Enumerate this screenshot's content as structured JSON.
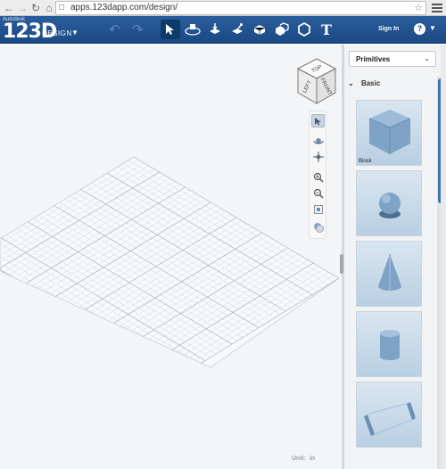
{
  "browser": {
    "url": "apps.123dapp.com/design/",
    "back_icon": "back-arrow-icon",
    "forward_icon": "forward-arrow-icon",
    "reload_icon": "reload-icon",
    "home_icon": "home-icon"
  },
  "app": {
    "brand_small": "Autodesk",
    "brand_big": "123D",
    "brand_design": "DESIGN",
    "sign_in": "Sign In",
    "help": "?",
    "accent": "#1f4f89",
    "tools": [
      {
        "name": "select-tool-icon",
        "active": true
      },
      {
        "name": "transform-tool-icon",
        "active": false
      },
      {
        "name": "snap-tool-icon",
        "active": false
      },
      {
        "name": "construct-tool-icon",
        "active": false
      },
      {
        "name": "modify-tool-icon",
        "active": false
      },
      {
        "name": "combine-tool-icon",
        "active": false
      },
      {
        "name": "measure-tool-icon",
        "active": false
      },
      {
        "name": "text-tool-icon",
        "active": false
      }
    ],
    "text_tool_label": "T"
  },
  "canvas": {
    "view_cube": {
      "top": "TOP",
      "left": "LEFT",
      "front": "FRONT"
    },
    "unit_label": "Unit:",
    "unit_value": "in"
  },
  "panel": {
    "dropdown_value": "Primitives",
    "section_title": "Basic",
    "items": [
      {
        "shape": "box",
        "label": "Block"
      },
      {
        "shape": "sphere",
        "label": ""
      },
      {
        "shape": "cone",
        "label": ""
      },
      {
        "shape": "cylinder",
        "label": ""
      },
      {
        "shape": "bracket",
        "label": ""
      }
    ],
    "thumb_color": "#7ea3c6"
  }
}
